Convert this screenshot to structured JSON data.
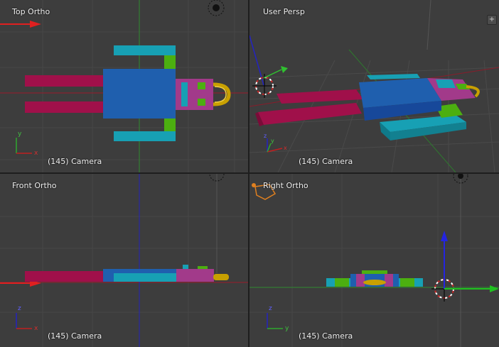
{
  "viewports": {
    "top_left": {
      "title": "Top Ortho",
      "info": "(145) Camera",
      "axis_labels": [
        "y",
        "x"
      ]
    },
    "top_right": {
      "title": "User Persp",
      "info": "(145) Camera",
      "axis_labels": [
        "z",
        "y",
        "x"
      ]
    },
    "bottom_left": {
      "title": "Front Ortho",
      "info": "(145) Camera",
      "axis_labels": [
        "z",
        "x"
      ]
    },
    "bottom_right": {
      "title": "Right Ortho",
      "info": "(145) Camera",
      "axis_labels": [
        "z",
        "y"
      ]
    }
  },
  "corner_button": {
    "label": "+"
  },
  "colors": {
    "background": "#3d3d3d",
    "grid": "#474747",
    "axis_x": "#9a1c2a",
    "axis_y": "#2e8b2e",
    "axis_z": "#2424b8",
    "crimson": "#a0104a",
    "blue": "#1f5fae",
    "cyan": "#17a0b4",
    "lime": "#4caf10",
    "magenta": "#a23a8a",
    "gold": "#c8a000"
  },
  "icons": [
    "camera-icon",
    "3d-cursor-icon",
    "lamp-icon",
    "axis-gizmo-icon"
  ]
}
